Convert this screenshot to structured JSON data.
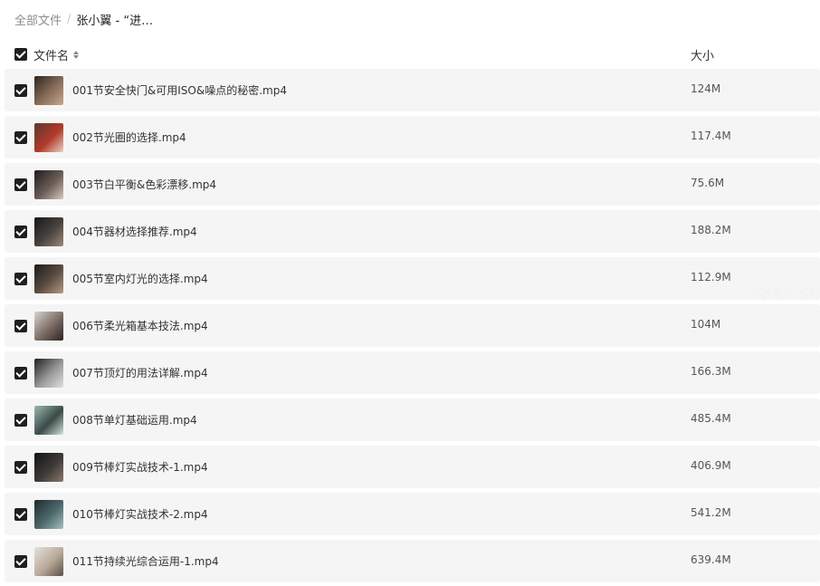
{
  "breadcrumb": {
    "root": "全部文件",
    "separator": "/",
    "current": "张小翼 - “进…"
  },
  "header": {
    "name_label": "文件名",
    "size_label": "大小"
  },
  "files": [
    {
      "name": "001节安全快门&可用ISO&噪点的秘密.mp4",
      "size": "124M",
      "thumb_colors": [
        "#2a2622",
        "#8a6e5a",
        "#c8a890"
      ]
    },
    {
      "name": "002节光圈的选择.mp4",
      "size": "117.4M",
      "thumb_colors": [
        "#5a3a2e",
        "#b23a2a",
        "#e8d2c0"
      ]
    },
    {
      "name": "003节白平衡&色彩漂移.mp4",
      "size": "75.6M",
      "thumb_colors": [
        "#1e1c1c",
        "#6b5e58",
        "#d9c8be"
      ]
    },
    {
      "name": "004节器材选择推荐.mp4",
      "size": "188.2M",
      "thumb_colors": [
        "#161616",
        "#4a4440",
        "#9e8a7a"
      ]
    },
    {
      "name": "005节室内灯光的选择.mp4",
      "size": "112.9M",
      "thumb_colors": [
        "#1a1a1a",
        "#5c4e44",
        "#b79a86"
      ]
    },
    {
      "name": "006节柔光箱基本技法.mp4",
      "size": "104M",
      "thumb_colors": [
        "#d8d4d0",
        "#7a6a62",
        "#2a2424"
      ]
    },
    {
      "name": "007节顶灯的用法详解.mp4",
      "size": "166.3M",
      "thumb_colors": [
        "#202020",
        "#9a9a9a",
        "#e0e0e0"
      ]
    },
    {
      "name": "008节单灯基础运用.mp4",
      "size": "485.4M",
      "thumb_colors": [
        "#9bb8b0",
        "#3a4a46",
        "#d6e2de"
      ]
    },
    {
      "name": "009节棒灯实战技术-1.mp4",
      "size": "406.9M",
      "thumb_colors": [
        "#141414",
        "#3e3a38",
        "#8a7a70"
      ]
    },
    {
      "name": "010节棒灯实战技术-2.mp4",
      "size": "541.2M",
      "thumb_colors": [
        "#1c2a2c",
        "#4e6a6c",
        "#a8c0be"
      ]
    },
    {
      "name": "011节持续光综合运用-1.mp4",
      "size": "639.4M",
      "thumb_colors": [
        "#e6e2dc",
        "#b8a898",
        "#5a4e46"
      ]
    }
  ],
  "watermark": "xyax.cn"
}
